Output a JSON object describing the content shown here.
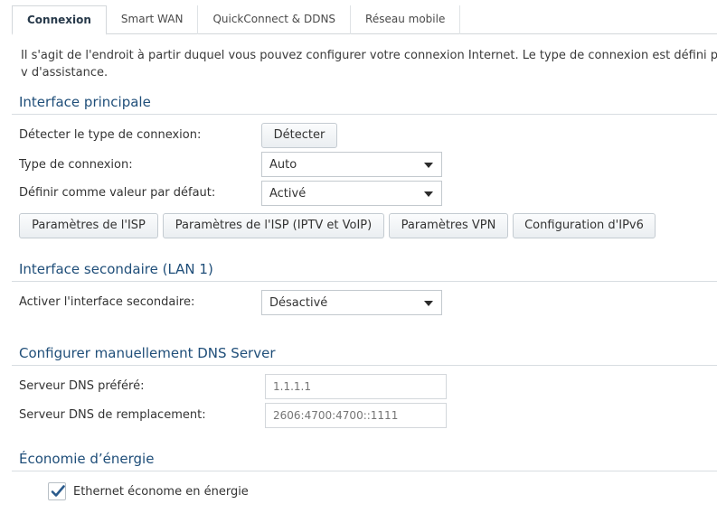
{
  "tabs": [
    {
      "label": "Connexion",
      "active": true
    },
    {
      "label": "Smart WAN",
      "active": false
    },
    {
      "label": "QuickConnect & DDNS",
      "active": false
    },
    {
      "label": "Réseau mobile",
      "active": false
    }
  ],
  "description": "Il s'agit de l'endroit à partir duquel vous pouvez configurer votre connexion Internet. Le type de connexion est défini par v d'assistance.",
  "primary": {
    "title": "Interface principale",
    "detect_label": "Détecter le type de connexion:",
    "detect_button": "Détecter",
    "conn_type_label": "Type de connexion:",
    "conn_type_value": "Auto",
    "default_label": "Définir comme valeur par défaut:",
    "default_value": "Activé",
    "buttons": {
      "isp": "Paramètres de l'ISP",
      "isp_iptv": "Paramètres de l'ISP (IPTV et VoIP)",
      "vpn": "Paramètres VPN",
      "ipv6": "Configuration d'IPv6"
    }
  },
  "secondary": {
    "title": "Interface secondaire (LAN 1)",
    "enable_label": "Activer l'interface secondaire:",
    "enable_value": "Désactivé"
  },
  "dns": {
    "title": "Configurer manuellement DNS Server",
    "preferred_label": "Serveur DNS préféré:",
    "preferred_placeholder": "1.1.1.1",
    "alternate_label": "Serveur DNS de remplacement:",
    "alternate_placeholder": "2606:4700:4700::1111"
  },
  "energy": {
    "title": "Économie d’énergie",
    "checkbox_label": "Ethernet économe en énergie",
    "checked": true
  },
  "colors": {
    "section_title": "#1f4e79",
    "check": "#2a5a8c"
  }
}
